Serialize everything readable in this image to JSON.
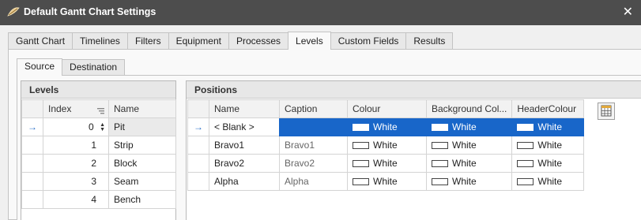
{
  "window": {
    "title": "Default Gantt Chart Settings",
    "close_glyph": "✕"
  },
  "tabs": [
    "Gantt Chart",
    "Timelines",
    "Filters",
    "Equipment",
    "Processes",
    "Levels",
    "Custom Fields",
    "Results"
  ],
  "active_tab": "Levels",
  "subtabs": [
    "Source",
    "Destination"
  ],
  "active_subtab": "Source",
  "levels": {
    "title": "Levels",
    "columns": [
      "Index",
      "Name"
    ],
    "rows": [
      {
        "index": "0",
        "name": "Pit"
      },
      {
        "index": "1",
        "name": "Strip"
      },
      {
        "index": "2",
        "name": "Block"
      },
      {
        "index": "3",
        "name": "Seam"
      },
      {
        "index": "4",
        "name": "Bench"
      }
    ]
  },
  "positions": {
    "title": "Positions",
    "columns": [
      "Name",
      "Caption",
      "Colour",
      "Background Col...",
      "HeaderColour"
    ],
    "rows": [
      {
        "name": "< Blank >",
        "caption": "",
        "colour": "White",
        "background": "White",
        "header": "White"
      },
      {
        "name": "Bravo1",
        "caption": "Bravo1",
        "colour": "White",
        "background": "White",
        "header": "White"
      },
      {
        "name": "Bravo2",
        "caption": "Bravo2",
        "colour": "White",
        "background": "White",
        "header": "White"
      },
      {
        "name": "Alpha",
        "caption": "Alpha",
        "colour": "White",
        "background": "White",
        "header": "White"
      }
    ]
  },
  "icons": {
    "app": "gantt-logo-icon",
    "close": "close-icon",
    "row_pointer": "row-pointer-icon",
    "sort": "sort-icon",
    "spin": "spin-buttons-icon",
    "customize": "column-chooser-icon"
  },
  "colors": {
    "titlebar": "#4d4d4d",
    "selection": "#1866c9",
    "indicator": "#2a6fc9"
  }
}
